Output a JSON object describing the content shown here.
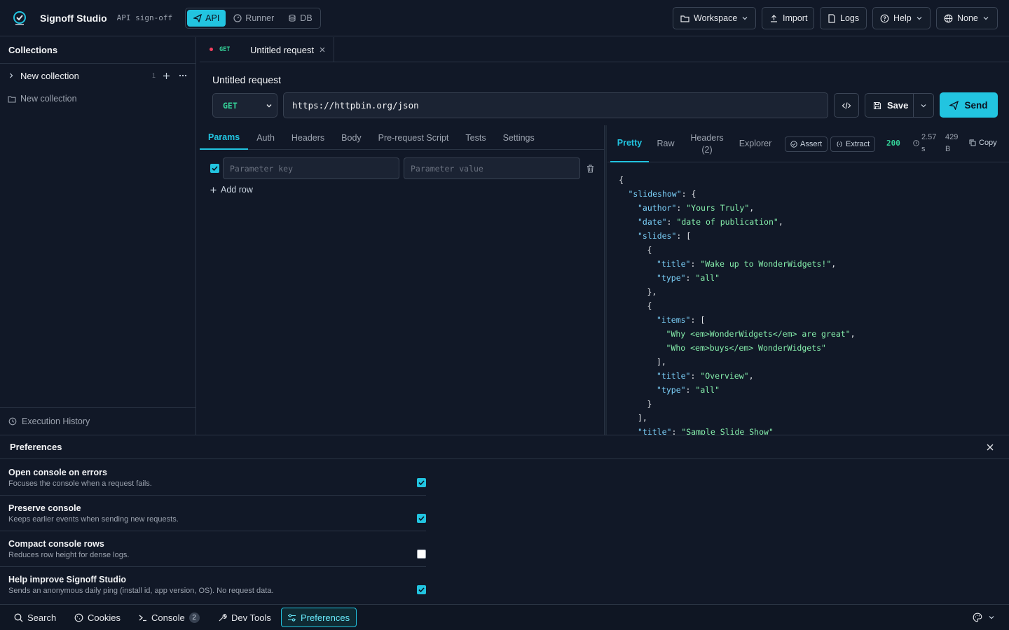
{
  "app": {
    "title": "Signoff Studio",
    "subtitle": "API sign-off"
  },
  "modes": [
    {
      "label": "API",
      "icon": "send-icon",
      "active": true
    },
    {
      "label": "Runner",
      "icon": "gauge-icon"
    },
    {
      "label": "DB",
      "icon": "database-icon"
    }
  ],
  "toolbar": {
    "workspace": "Workspace",
    "import": "Import",
    "logs": "Logs",
    "help": "Help",
    "environment": "None"
  },
  "sidebar": {
    "header": "Collections",
    "collection": {
      "name": "New collection",
      "count": "1"
    },
    "items": [
      "New collection"
    ],
    "footer": "Execution History"
  },
  "request": {
    "tab": {
      "method": "GET",
      "name": "Untitled request"
    },
    "title": "Untitled request",
    "method": "GET",
    "url": "https://httpbin.org/json",
    "save_label": "Save",
    "send_label": "Send",
    "tabs": [
      "Params",
      "Auth",
      "Headers",
      "Body",
      "Pre-request Script",
      "Tests",
      "Settings"
    ],
    "active_tab": "Params",
    "params": {
      "key_placeholder": "Parameter key",
      "value_placeholder": "Parameter value",
      "add_row": "Add row"
    }
  },
  "response": {
    "tabs": {
      "pretty": "Pretty",
      "raw": "Raw",
      "headers": "Headers",
      "headers_count": "(2)",
      "explorer": "Explorer"
    },
    "assert_label": "Assert",
    "extract_label": "Extract",
    "status": "200",
    "time_value": "2.57",
    "time_unit": "s",
    "size_value": "429",
    "size_unit": "B",
    "copy_label": "Copy",
    "body_lines": [
      {
        "indent": 0,
        "text": "{"
      },
      {
        "indent": 1,
        "key": "\"slideshow\"",
        "rest": ": {"
      },
      {
        "indent": 2,
        "key": "\"author\"",
        "rest": ": ",
        "value": "\"Yours Truly\"",
        "tail": ","
      },
      {
        "indent": 2,
        "key": "\"date\"",
        "rest": ": ",
        "value": "\"date of publication\"",
        "tail": ","
      },
      {
        "indent": 2,
        "key": "\"slides\"",
        "rest": ": ["
      },
      {
        "indent": 3,
        "text": "{"
      },
      {
        "indent": 4,
        "key": "\"title\"",
        "rest": ": ",
        "value": "\"Wake up to WonderWidgets!\"",
        "tail": ","
      },
      {
        "indent": 4,
        "key": "\"type\"",
        "rest": ": ",
        "value": "\"all\""
      },
      {
        "indent": 3,
        "text": "},"
      },
      {
        "indent": 3,
        "text": "{"
      },
      {
        "indent": 4,
        "key": "\"items\"",
        "rest": ": ["
      },
      {
        "indent": 5,
        "value": "\"Why <em>WonderWidgets</em> are great\"",
        "tail": ","
      },
      {
        "indent": 5,
        "value": "\"Who <em>buys</em> WonderWidgets\""
      },
      {
        "indent": 4,
        "text": "],"
      },
      {
        "indent": 4,
        "key": "\"title\"",
        "rest": ": ",
        "value": "\"Overview\"",
        "tail": ","
      },
      {
        "indent": 4,
        "key": "\"type\"",
        "rest": ": ",
        "value": "\"all\""
      },
      {
        "indent": 3,
        "text": "}"
      },
      {
        "indent": 2,
        "text": "],"
      },
      {
        "indent": 2,
        "key": "\"title\"",
        "rest": ": ",
        "value": "\"Sample Slide Show\""
      }
    ]
  },
  "preferences": {
    "title": "Preferences",
    "items": [
      {
        "title": "Open console on errors",
        "desc": "Focuses the console when a request fails.",
        "checked": true
      },
      {
        "title": "Preserve console",
        "desc": "Keeps earlier events when sending new requests.",
        "checked": true
      },
      {
        "title": "Compact console rows",
        "desc": "Reduces row height for dense logs.",
        "checked": false
      },
      {
        "title": "Help improve Signoff Studio",
        "desc": "Sends an anonymous daily ping (install id, app version, OS). No request data.",
        "checked": true
      }
    ]
  },
  "statusbar": {
    "search": "Search",
    "cookies": "Cookies",
    "console": "Console",
    "console_count": "2",
    "devtools": "Dev Tools",
    "preferences": "Preferences"
  },
  "colors": {
    "accent": "#22c4e0",
    "method_get": "#34d399",
    "background": "#111827"
  }
}
